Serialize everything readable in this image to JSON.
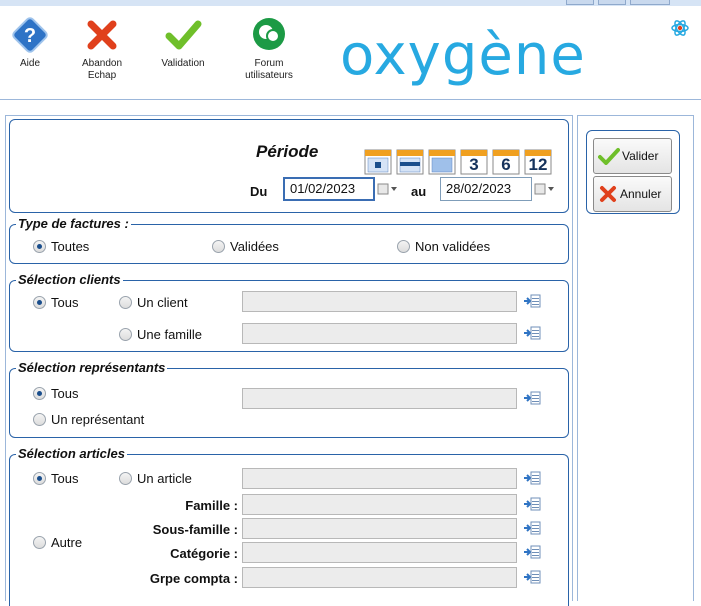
{
  "toolbar": {
    "aide": "Aide",
    "abandon_line1": "Abandon",
    "abandon_line2": "Echap",
    "validation": "Validation",
    "forum_line1": "Forum",
    "forum_line2": "utilisateurs"
  },
  "logo": "oxygène",
  "periode": {
    "title": "Période",
    "du_label": "Du",
    "au_label": "au",
    "date_from": "01/02/2023",
    "date_to": "28/02/2023",
    "preset_labels": [
      "3",
      "6",
      "12"
    ]
  },
  "type_factures": {
    "legend": "Type de factures :",
    "options": [
      "Toutes",
      "Validées",
      "Non validées"
    ],
    "selected": "Toutes"
  },
  "selection_clients": {
    "legend": "Sélection clients",
    "tous": "Tous",
    "un_client": "Un client",
    "une_famille": "Une famille"
  },
  "selection_representants": {
    "legend": "Sélection représentants",
    "tous": "Tous",
    "un_representant": "Un représentant"
  },
  "selection_articles": {
    "legend": "Sélection articles",
    "tous": "Tous",
    "un_article": "Un article",
    "autre": "Autre",
    "famille": "Famille :",
    "sous_famille": "Sous-famille :",
    "categorie": "Catégorie :",
    "grpe_compta": "Grpe compta :"
  },
  "actions": {
    "valider": "Valider",
    "annuler": "Annuler"
  },
  "colors": {
    "accent": "#27a9e1",
    "group_border": "#2a63a8",
    "panel_border": "#9cb7da"
  }
}
